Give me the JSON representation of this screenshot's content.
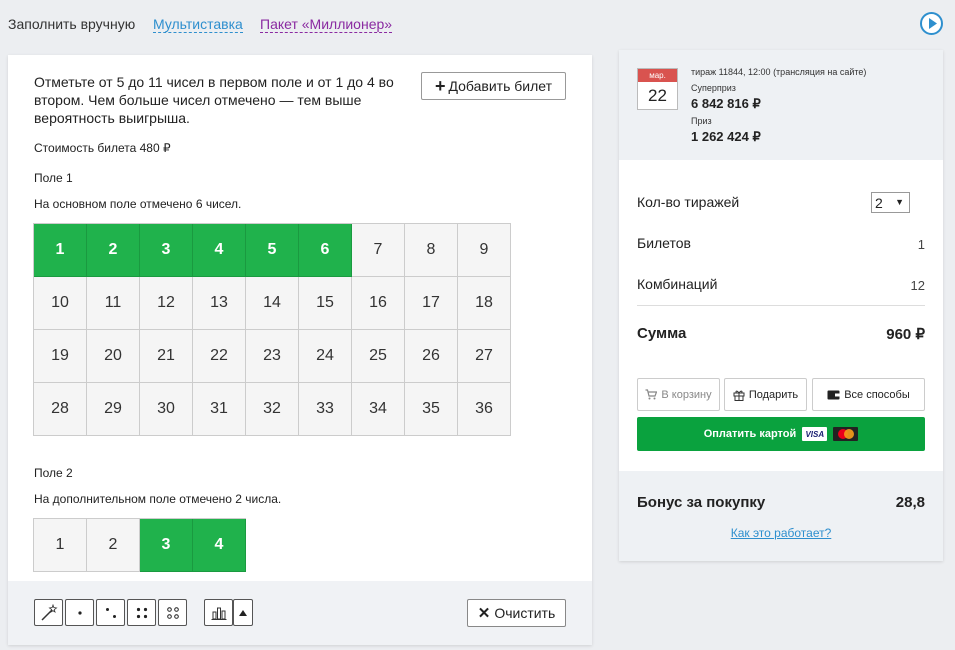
{
  "modes": {
    "manual": "Заполнить вручную",
    "multi": "Мультиставка",
    "pack": "Пакет «Миллионер»"
  },
  "instructions": "Отметьте от 5 до 11 чисел в первом поле и от 1 до 4 во втором. Чем больше чисел отмечено — тем выше вероятность выигрыша.",
  "add_ticket": "Добавить билет",
  "ticket_price": "Стоимость билета 480 ₽",
  "field1": {
    "title": "Поле 1",
    "info": "На основном поле отмечено 6 чисел.",
    "numbers": [
      "1",
      "2",
      "3",
      "4",
      "5",
      "6",
      "7",
      "8",
      "9",
      "10",
      "11",
      "12",
      "13",
      "14",
      "15",
      "16",
      "17",
      "18",
      "19",
      "20",
      "21",
      "22",
      "23",
      "24",
      "25",
      "26",
      "27",
      "28",
      "29",
      "30",
      "31",
      "32",
      "33",
      "34",
      "35",
      "36"
    ],
    "selected": [
      "1",
      "2",
      "3",
      "4",
      "5",
      "6"
    ]
  },
  "field2": {
    "title": "Поле 2",
    "info": "На дополнительном поле отмечено 2 числа.",
    "numbers": [
      "1",
      "2",
      "3",
      "4"
    ],
    "selected": [
      "3",
      "4"
    ]
  },
  "toolbar": {
    "icons": [
      "magic-wand-icon",
      "dice-1-icon",
      "dice-2-icon",
      "dice-4-icon",
      "dice-4-alt-icon",
      "stats-chart-icon",
      "arrow-up-icon"
    ],
    "clear_label": "Очистить"
  },
  "draw": {
    "month": "мар.",
    "day": "22",
    "info": "тираж 11844, 12:00 (трансляция на сайте)",
    "superprize_label": "Суперприз",
    "superprize": "6 842 816 ₽",
    "prize_label": "Приз",
    "prize": "1 262 424 ₽"
  },
  "summary": {
    "draws_label": "Кол-во тиражей",
    "draws_value": "2",
    "tickets_label": "Билетов",
    "tickets_value": "1",
    "combos_label": "Комбинаций",
    "combos_value": "12",
    "sum_label": "Сумма",
    "sum_value": "960 ₽"
  },
  "actions": {
    "cart": "В корзину",
    "gift": "Подарить",
    "all": "Все способы",
    "pay": "Оплатить картой",
    "visa": "VISA"
  },
  "bonus": {
    "label": "Бонус за покупку",
    "value": "28,8",
    "how": "Как это работает?"
  },
  "colors": {
    "selected_green": "#20b24c",
    "pay_green": "#0aa23e",
    "link_blue": "#2e8fce",
    "pack_purple": "#8a2aa1",
    "calendar_red": "#d9534f"
  }
}
